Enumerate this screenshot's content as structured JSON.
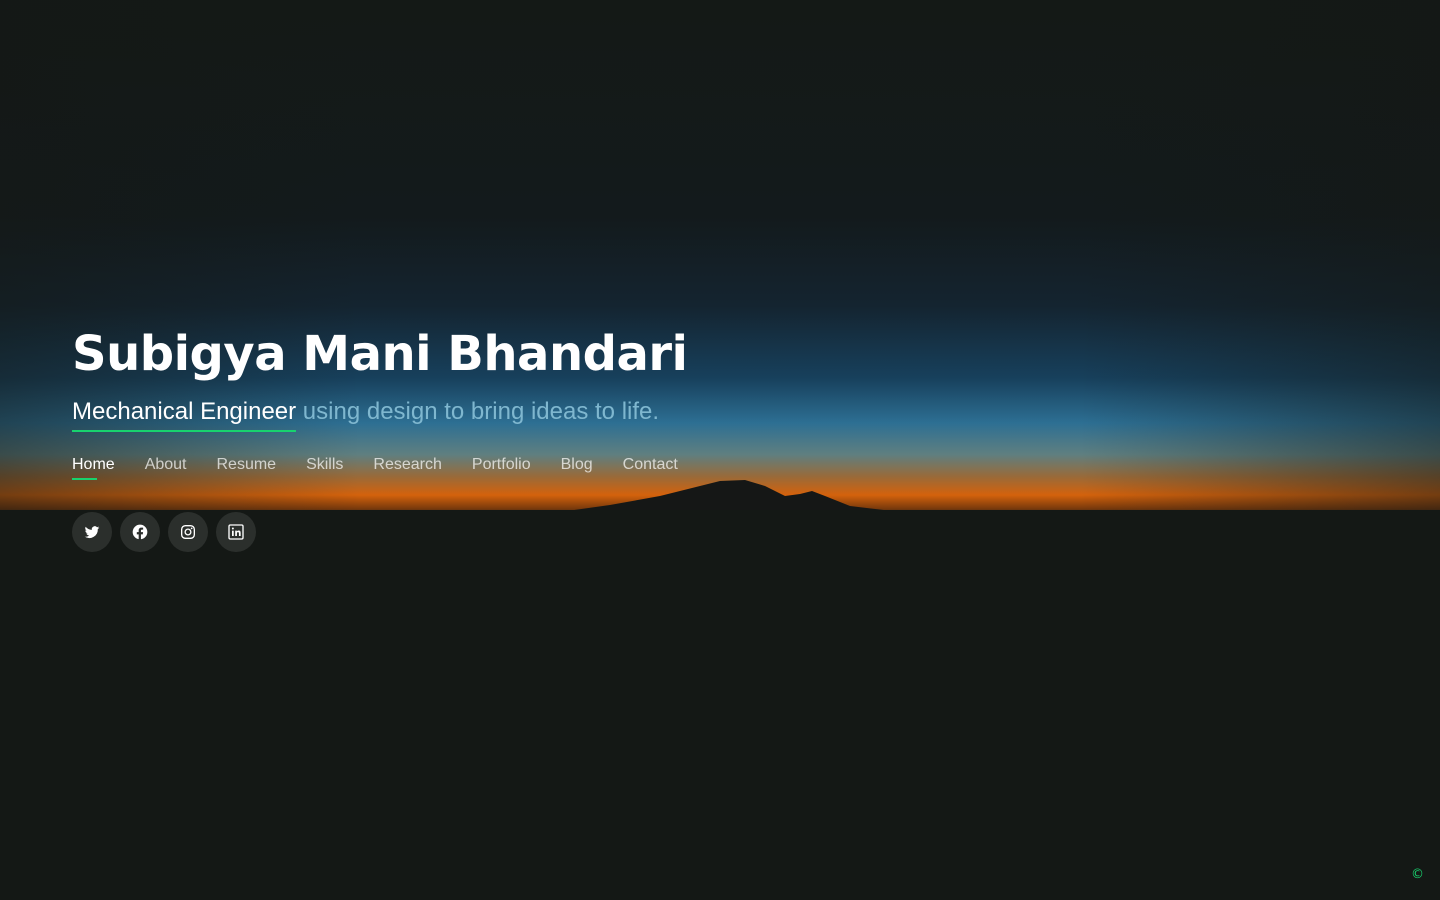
{
  "hero": {
    "name": "Subigya Mani Bhandari",
    "role": "Mechanical Engineer",
    "tagline_rest": " using design to bring ideas to life."
  },
  "nav": {
    "items": [
      {
        "label": "Home",
        "active": true
      },
      {
        "label": "About"
      },
      {
        "label": "Resume"
      },
      {
        "label": "Skills"
      },
      {
        "label": "Research"
      },
      {
        "label": "Portfolio"
      },
      {
        "label": "Blog"
      },
      {
        "label": "Contact"
      }
    ]
  },
  "social": {
    "icons": [
      "twitter-icon",
      "facebook-icon",
      "instagram-icon",
      "linkedin-icon"
    ]
  },
  "footer": {
    "copyright": "©"
  },
  "colors": {
    "accent": "#18d26e",
    "background": "#141815",
    "tagline": "#7fb7cf"
  }
}
